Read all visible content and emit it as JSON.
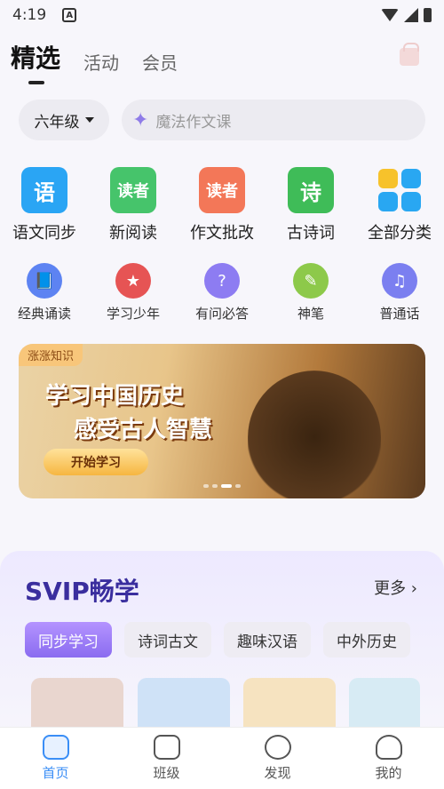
{
  "status": {
    "time": "4:19"
  },
  "tabs": [
    {
      "label": "精选",
      "active": true
    },
    {
      "label": "活动",
      "active": false
    },
    {
      "label": "会员",
      "active": false
    }
  ],
  "grade": {
    "value": "六年级"
  },
  "search": {
    "placeholder": "魔法作文课"
  },
  "main_grid": [
    {
      "label": "语文同步",
      "glyph": "语",
      "icon": "chinese-sync-icon",
      "color": "#2aa5f4"
    },
    {
      "label": "新阅读",
      "glyph": "读者",
      "icon": "new-reading-icon",
      "color": "#46c46b"
    },
    {
      "label": "作文批改",
      "glyph": "读者",
      "icon": "essay-correction-icon",
      "color": "#f37758"
    },
    {
      "label": "古诗词",
      "glyph": "诗",
      "icon": "ancient-poetry-icon",
      "color": "#3fbc58"
    },
    {
      "label": "全部分类",
      "glyph": "",
      "icon": "all-categories-icon",
      "color": "#29a7f2"
    }
  ],
  "sub_grid": [
    {
      "label": "经典诵读",
      "icon": "classic-recitation-icon",
      "color": "#5d83f2"
    },
    {
      "label": "学习少年",
      "icon": "study-youth-icon",
      "color": "#e65454"
    },
    {
      "label": "有问必答",
      "icon": "qa-icon",
      "color": "#8d7cf2"
    },
    {
      "label": "神笔",
      "icon": "magic-pen-icon",
      "color": "#8dc94a"
    },
    {
      "label": "普通话",
      "icon": "mandarin-icon",
      "color": "#7b7ff0"
    }
  ],
  "banner": {
    "tag": "涨涨知识",
    "title_line1": "学习中国历史",
    "title_line2": "感受古人智慧",
    "button": "开始学习"
  },
  "svip": {
    "title": "SVIP畅学",
    "more": "更多",
    "chips": [
      "同步学习",
      "诗词古文",
      "趣味汉语",
      "中外历史"
    ]
  },
  "bottom_nav": [
    "首页",
    "班级",
    "发现",
    "我的"
  ]
}
